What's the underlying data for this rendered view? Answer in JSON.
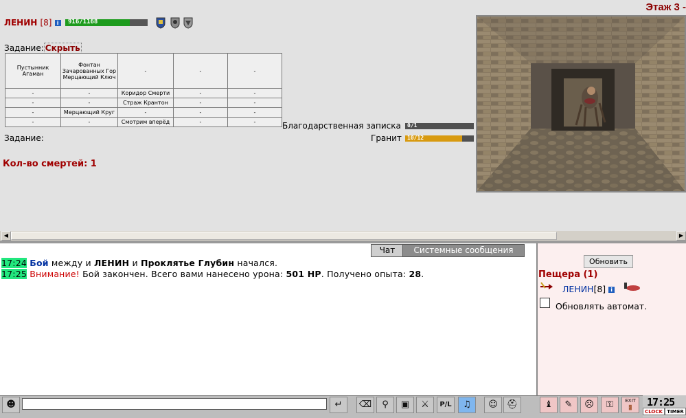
{
  "header": {
    "floor_title": "Этаж 3 -",
    "player_name": "ЛЕНИН",
    "player_level": "[8]",
    "info_icon": "i",
    "hp_text": "916/1168",
    "hp_fraction": 0.784
  },
  "quest": {
    "label": "Задание:",
    "hide_link": "Скрыть",
    "table": [
      [
        "Пустынник Агаман",
        "Фонтан Зачарованных Гор Мерцающий Ключ",
        "-",
        "-",
        "-"
      ],
      [
        "-",
        "-",
        "Коридор Смерти",
        "-",
        "-"
      ],
      [
        "-",
        "-",
        "Страж Крантон",
        "-",
        "-"
      ],
      [
        "-",
        "Мерцающий Круг",
        "-",
        "-",
        "-"
      ],
      [
        "-",
        "-",
        "Смотрим вперёд",
        "-",
        "-"
      ]
    ],
    "label2": "Задание:",
    "deaths": "Кол-во смертей: 1"
  },
  "resources": [
    {
      "name": "Благодарственная записка",
      "value": "0/1",
      "fraction": 0.0,
      "color": "#d0a020"
    },
    {
      "name": "Гранит",
      "value": "10/12",
      "fraction": 0.833,
      "color": "#d89a10"
    }
  ],
  "chat": {
    "tab_chat": "Чат",
    "tab_system": "Системные сообщения",
    "line1": {
      "time": "17:24",
      "w1": "Бой",
      "t1": " между и ",
      "w2": "ЛЕНИН",
      "t2": " и ",
      "w3": "Проклятье Глубин",
      "t3": " начался."
    },
    "line2": {
      "time": "17:25",
      "w1": "Внимание!",
      "t1": " Бой закончен. Всего вами нанесено урона: ",
      "w2": "501 HP",
      "t2": ". Получено опыта: ",
      "w3": "28",
      "t3": "."
    }
  },
  "right_panel": {
    "refresh_button": "Обновить",
    "cave_title": "Пещера (1)",
    "player_name": "ЛЕНИН",
    "player_level": "[8]",
    "auto_refresh_label": "Обновлять автомат."
  },
  "toolbar": {
    "clock_time": "17:25",
    "clock_button": "CLOCK",
    "timer_button": "TIMER",
    "exit_label": "EXIT",
    "icons": [
      "smile-speaker-icon",
      "enter-icon",
      "eraser-icon",
      "filter-icon",
      "save-icon",
      "fight-icon",
      "pl-icon",
      "music-icon",
      "smiley-icon",
      "helmet-icon",
      "bag-icon",
      "scroll-icon",
      "mask-icon",
      "lock-icon",
      "exit-icon"
    ]
  },
  "colors": {
    "accent_red": "#a00000",
    "hp_green": "#1d9b1d",
    "time_highlight": "#22e77e",
    "panel_pink": "#fcefef"
  }
}
